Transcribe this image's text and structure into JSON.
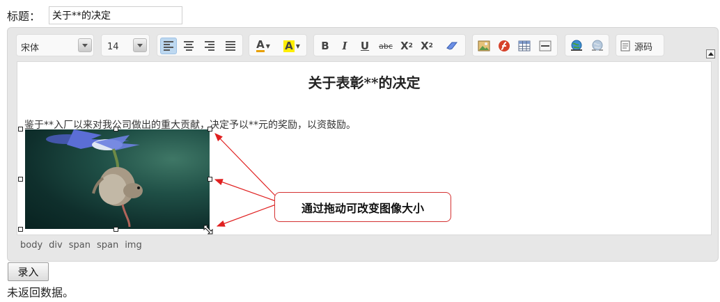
{
  "form": {
    "title_label": "标题：",
    "title_value": "关于**的决定",
    "submit_label": "录入",
    "result_text": "未返回数据。"
  },
  "toolbar": {
    "font_family": "宋体",
    "font_size": "14",
    "source_label": "源码",
    "strikethrough_label": "abc"
  },
  "content": {
    "heading": "关于表彰**的决定",
    "paragraph": "鉴于**入厂以来对我公司做出的重大贡献，决定予以**元的奖励，以资鼓励。"
  },
  "statusbar": [
    "body",
    "div",
    "span",
    "span",
    "img"
  ],
  "callout": "通过拖动可改变图像大小",
  "colors": {
    "callout_border": "#d43030",
    "arrow": "#e02020",
    "active_button": "#bdd8f0"
  }
}
